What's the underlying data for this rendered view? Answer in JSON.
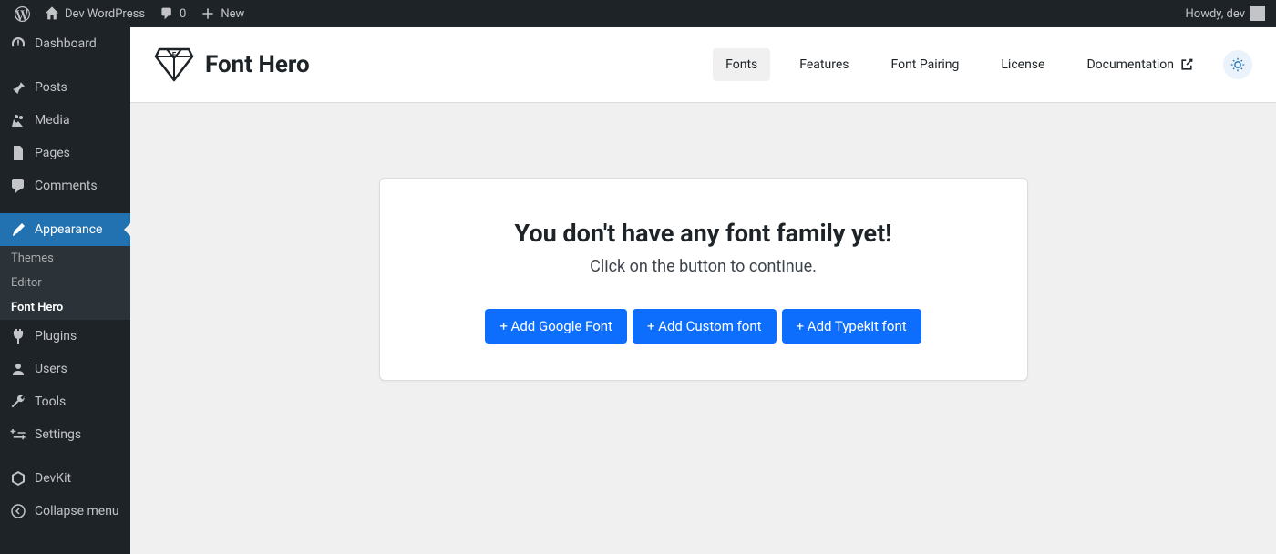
{
  "adminbar": {
    "site_name": "Dev WordPress",
    "comments_count": "0",
    "new_label": "New",
    "howdy": "Howdy, dev"
  },
  "sidebar": {
    "dashboard": "Dashboard",
    "posts": "Posts",
    "media": "Media",
    "pages": "Pages",
    "comments": "Comments",
    "appearance": "Appearance",
    "submenu": {
      "themes": "Themes",
      "editor": "Editor",
      "fonthero": "Font Hero"
    },
    "plugins": "Plugins",
    "users": "Users",
    "tools": "Tools",
    "settings": "Settings",
    "devkit": "DevKit",
    "collapse": "Collapse menu"
  },
  "header": {
    "brand": "Font Hero",
    "tabs": {
      "fonts": "Fonts",
      "features": "Features",
      "pairing": "Font Pairing",
      "license": "License",
      "docs": "Documentation"
    }
  },
  "card": {
    "title": "You don't have any font family yet!",
    "subtitle": "Click on the button to continue.",
    "btn_google": "+ Add Google Font",
    "btn_custom": "+ Add Custom font",
    "btn_typekit": "+ Add Typekit font"
  }
}
